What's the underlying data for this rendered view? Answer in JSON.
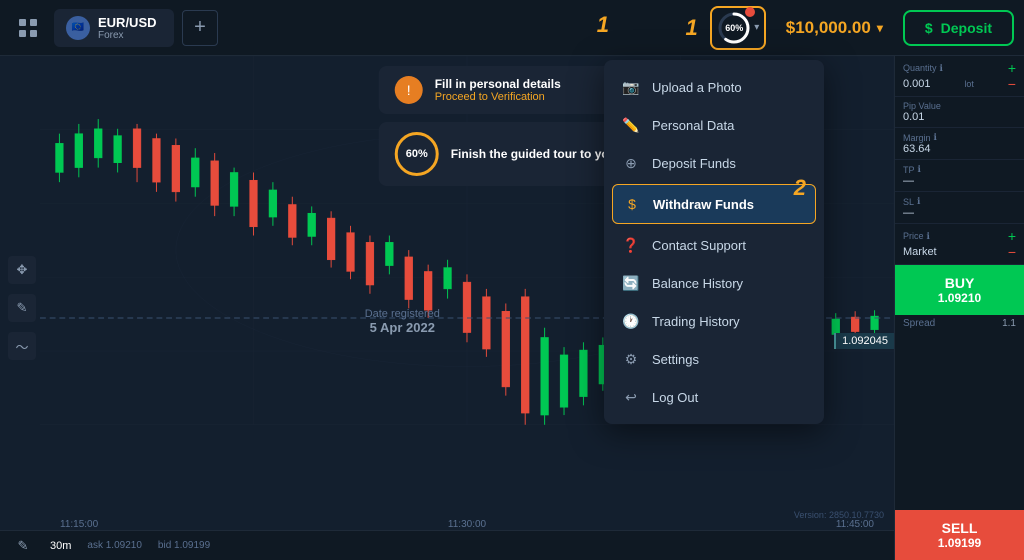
{
  "topbar": {
    "grid_icon": "grid-icon",
    "pair": {
      "name": "EUR/USD",
      "category": "Forex"
    },
    "add_tab_label": "+",
    "progress": {
      "percent": "60%",
      "label": "60%"
    },
    "balance": "$10,000.00",
    "deposit_label": "Deposit"
  },
  "num_labels": {
    "one": "1",
    "two": "2"
  },
  "notifications": {
    "card1": {
      "title": "Fill in personal details",
      "link": "Proceed to Verification"
    },
    "card2": {
      "progress": "60%",
      "title": "Finish the guided tour to your first real trade"
    }
  },
  "dropdown": {
    "items": [
      {
        "id": "upload-photo",
        "icon": "📷",
        "label": "Upload a Photo"
      },
      {
        "id": "personal-data",
        "icon": "✏️",
        "label": "Personal Data"
      },
      {
        "id": "deposit-funds",
        "icon": "⊕",
        "label": "Deposit Funds"
      },
      {
        "id": "withdraw-funds",
        "icon": "$",
        "label": "Withdraw Funds",
        "active": true
      },
      {
        "id": "contact-support",
        "icon": "❓",
        "label": "Contact Support"
      },
      {
        "id": "balance-history",
        "icon": "🔄",
        "label": "Balance History"
      },
      {
        "id": "trading-history",
        "icon": "🕐",
        "label": "Trading History"
      },
      {
        "id": "settings",
        "icon": "⚙",
        "label": "Settings"
      },
      {
        "id": "log-out",
        "icon": "↩",
        "label": "Log Out"
      }
    ]
  },
  "chart": {
    "times": [
      "11:15:00",
      "11:30:00",
      "11:45:00"
    ],
    "date_registered_label": "Date registered",
    "date_registered_value": "5 Apr 2022",
    "price_indicator": "1.092045",
    "version": "Version: 2850.10.7730",
    "timeframe": "30m"
  },
  "right_panel": {
    "quantity_label": "Quantity",
    "quantity_info": "ℹ",
    "quantity_value": "0.001",
    "quantity_unit": "lot",
    "pip_label": "Pip Value",
    "pip_value": "0.01",
    "margin_label": "Margin",
    "margin_info": "ℹ",
    "margin_value": "63.64",
    "tp_label": "TP",
    "tp_info": "ℹ",
    "tp_value": "—",
    "sl_label": "SL",
    "sl_info": "ℹ",
    "sl_value": "—",
    "price_label": "Price",
    "price_info": "ℹ",
    "price_value": "Market",
    "buy_label": "BUY",
    "buy_price": "1.09210",
    "spread_label": "Spread",
    "spread_value": "1.1",
    "sell_label": "SELL",
    "sell_price": "1.09199",
    "ask_label": "ask 1.09210",
    "bid_label": "bid 1.09199"
  }
}
